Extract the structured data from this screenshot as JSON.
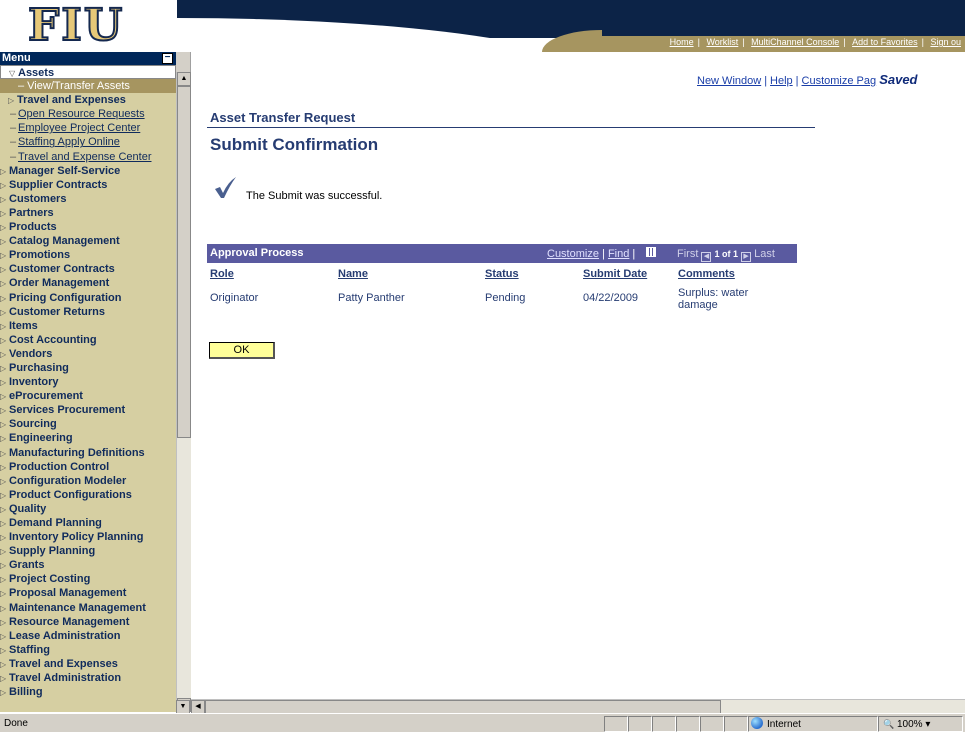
{
  "header": {
    "logo": "FIU",
    "top_links": [
      "Home",
      "Worklist",
      "MultiChannel Console",
      "Add to Favorites",
      "Sign ou"
    ]
  },
  "menu": {
    "title": "Menu",
    "items": [
      {
        "label": "Assets",
        "kind": "open"
      },
      {
        "label": "– View/Transfer Assets",
        "kind": "sel"
      },
      {
        "label": "Travel and Expenses",
        "kind": "sub"
      },
      {
        "label": "Open Resource Requests",
        "kind": "link"
      },
      {
        "label": "Employee Project Center",
        "kind": "link"
      },
      {
        "label": "Staffing Apply Online",
        "kind": "link"
      },
      {
        "label": "Travel and Expense Center",
        "kind": "link"
      },
      {
        "label": "Manager Self-Service",
        "kind": "folder"
      },
      {
        "label": "Supplier Contracts",
        "kind": "folder"
      },
      {
        "label": "Customers",
        "kind": "folder"
      },
      {
        "label": "Partners",
        "kind": "folder"
      },
      {
        "label": "Products",
        "kind": "folder"
      },
      {
        "label": "Catalog Management",
        "kind": "folder"
      },
      {
        "label": "Promotions",
        "kind": "folder"
      },
      {
        "label": "Customer Contracts",
        "kind": "folder"
      },
      {
        "label": "Order Management",
        "kind": "folder"
      },
      {
        "label": "Pricing Configuration",
        "kind": "folder"
      },
      {
        "label": "Customer Returns",
        "kind": "folder"
      },
      {
        "label": "Items",
        "kind": "folder"
      },
      {
        "label": "Cost Accounting",
        "kind": "folder"
      },
      {
        "label": "Vendors",
        "kind": "folder"
      },
      {
        "label": "Purchasing",
        "kind": "folder"
      },
      {
        "label": "Inventory",
        "kind": "folder"
      },
      {
        "label": "eProcurement",
        "kind": "folder"
      },
      {
        "label": "Services Procurement",
        "kind": "folder"
      },
      {
        "label": "Sourcing",
        "kind": "folder"
      },
      {
        "label": "Engineering",
        "kind": "folder"
      },
      {
        "label": "Manufacturing Definitions",
        "kind": "folder"
      },
      {
        "label": "Production Control",
        "kind": "folder"
      },
      {
        "label": "Configuration Modeler",
        "kind": "folder"
      },
      {
        "label": "Product Configurations",
        "kind": "folder"
      },
      {
        "label": "Quality",
        "kind": "folder"
      },
      {
        "label": "Demand Planning",
        "kind": "folder"
      },
      {
        "label": "Inventory Policy Planning",
        "kind": "folder"
      },
      {
        "label": "Supply Planning",
        "kind": "folder"
      },
      {
        "label": "Grants",
        "kind": "folder"
      },
      {
        "label": "Project Costing",
        "kind": "folder"
      },
      {
        "label": "Proposal Management",
        "kind": "folder"
      },
      {
        "label": "Maintenance Management",
        "kind": "folder"
      },
      {
        "label": "Resource Management",
        "kind": "folder"
      },
      {
        "label": "Lease Administration",
        "kind": "folder"
      },
      {
        "label": "Staffing",
        "kind": "folder"
      },
      {
        "label": "Travel and Expenses",
        "kind": "folder"
      },
      {
        "label": "Travel Administration",
        "kind": "folder"
      },
      {
        "label": "Billing",
        "kind": "folder"
      }
    ]
  },
  "page_links": {
    "new_window": "New Window",
    "help": "Help",
    "customize": "Customize Pag",
    "saved": "Saved"
  },
  "page": {
    "title": "Asset Transfer Request",
    "subtitle": "Submit Confirmation",
    "success_message": "The Submit was successful.",
    "ok_button": "OK"
  },
  "grid": {
    "title": "Approval Process",
    "customize": "Customize",
    "find": "Find",
    "first": "First",
    "count": "1 of 1",
    "last": "Last",
    "columns": [
      "Role",
      "Name",
      "Status",
      "Submit Date",
      "Comments"
    ],
    "row": {
      "role": "Originator",
      "name": "Patty Panther",
      "status": "Pending",
      "submit_date": "04/22/2009",
      "comments": "Surplus: water damage"
    }
  },
  "statusbar": {
    "text": "Done",
    "zone": "Internet",
    "zoom": "100%"
  },
  "colors": {
    "navy": "#0c2347",
    "gold": "#a69560",
    "menu_bg": "#d6cfa2",
    "grid_header": "#5a5aa0",
    "ok_button": "#ffff99"
  }
}
